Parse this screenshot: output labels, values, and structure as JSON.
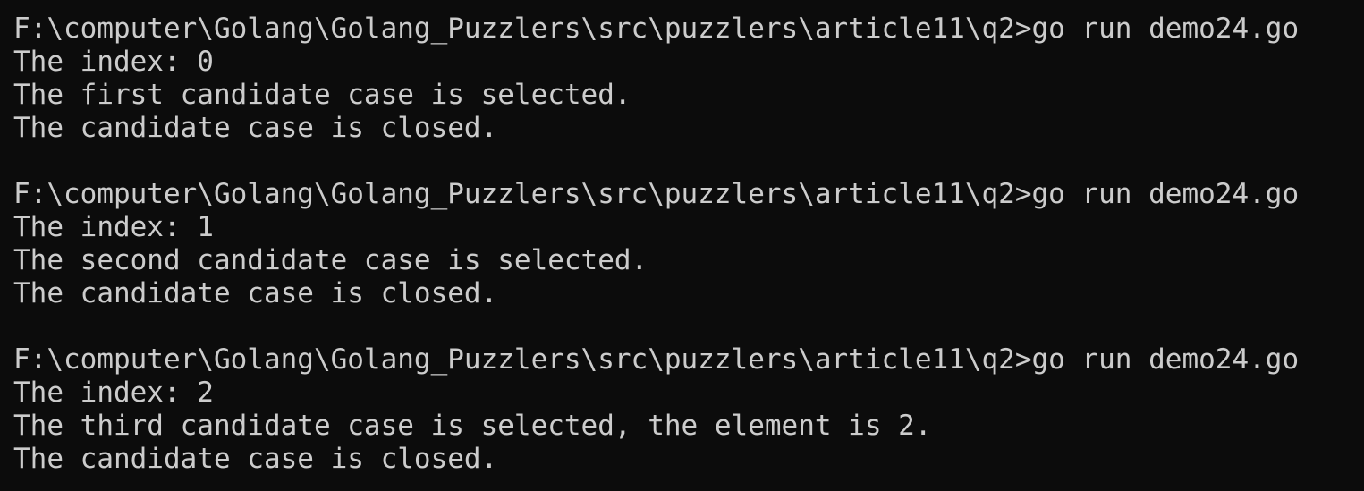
{
  "terminal": {
    "background": "#0c0c0c",
    "foreground": "#cccccc",
    "runs": [
      {
        "prompt": "F:\\computer\\Golang\\Golang_Puzzlers\\src\\puzzlers\\article11\\q2>",
        "command": "go run demo24.go",
        "output": [
          "The index: 0",
          "The first candidate case is selected.",
          "The candidate case is closed."
        ]
      },
      {
        "prompt": "F:\\computer\\Golang\\Golang_Puzzlers\\src\\puzzlers\\article11\\q2>",
        "command": "go run demo24.go",
        "output": [
          "The index: 1",
          "The second candidate case is selected.",
          "The candidate case is closed."
        ]
      },
      {
        "prompt": "F:\\computer\\Golang\\Golang_Puzzlers\\src\\puzzlers\\article11\\q2>",
        "command": "go run demo24.go",
        "output": [
          "The index: 2",
          "The third candidate case is selected, the element is 2.",
          "The candidate case is closed."
        ]
      }
    ]
  }
}
